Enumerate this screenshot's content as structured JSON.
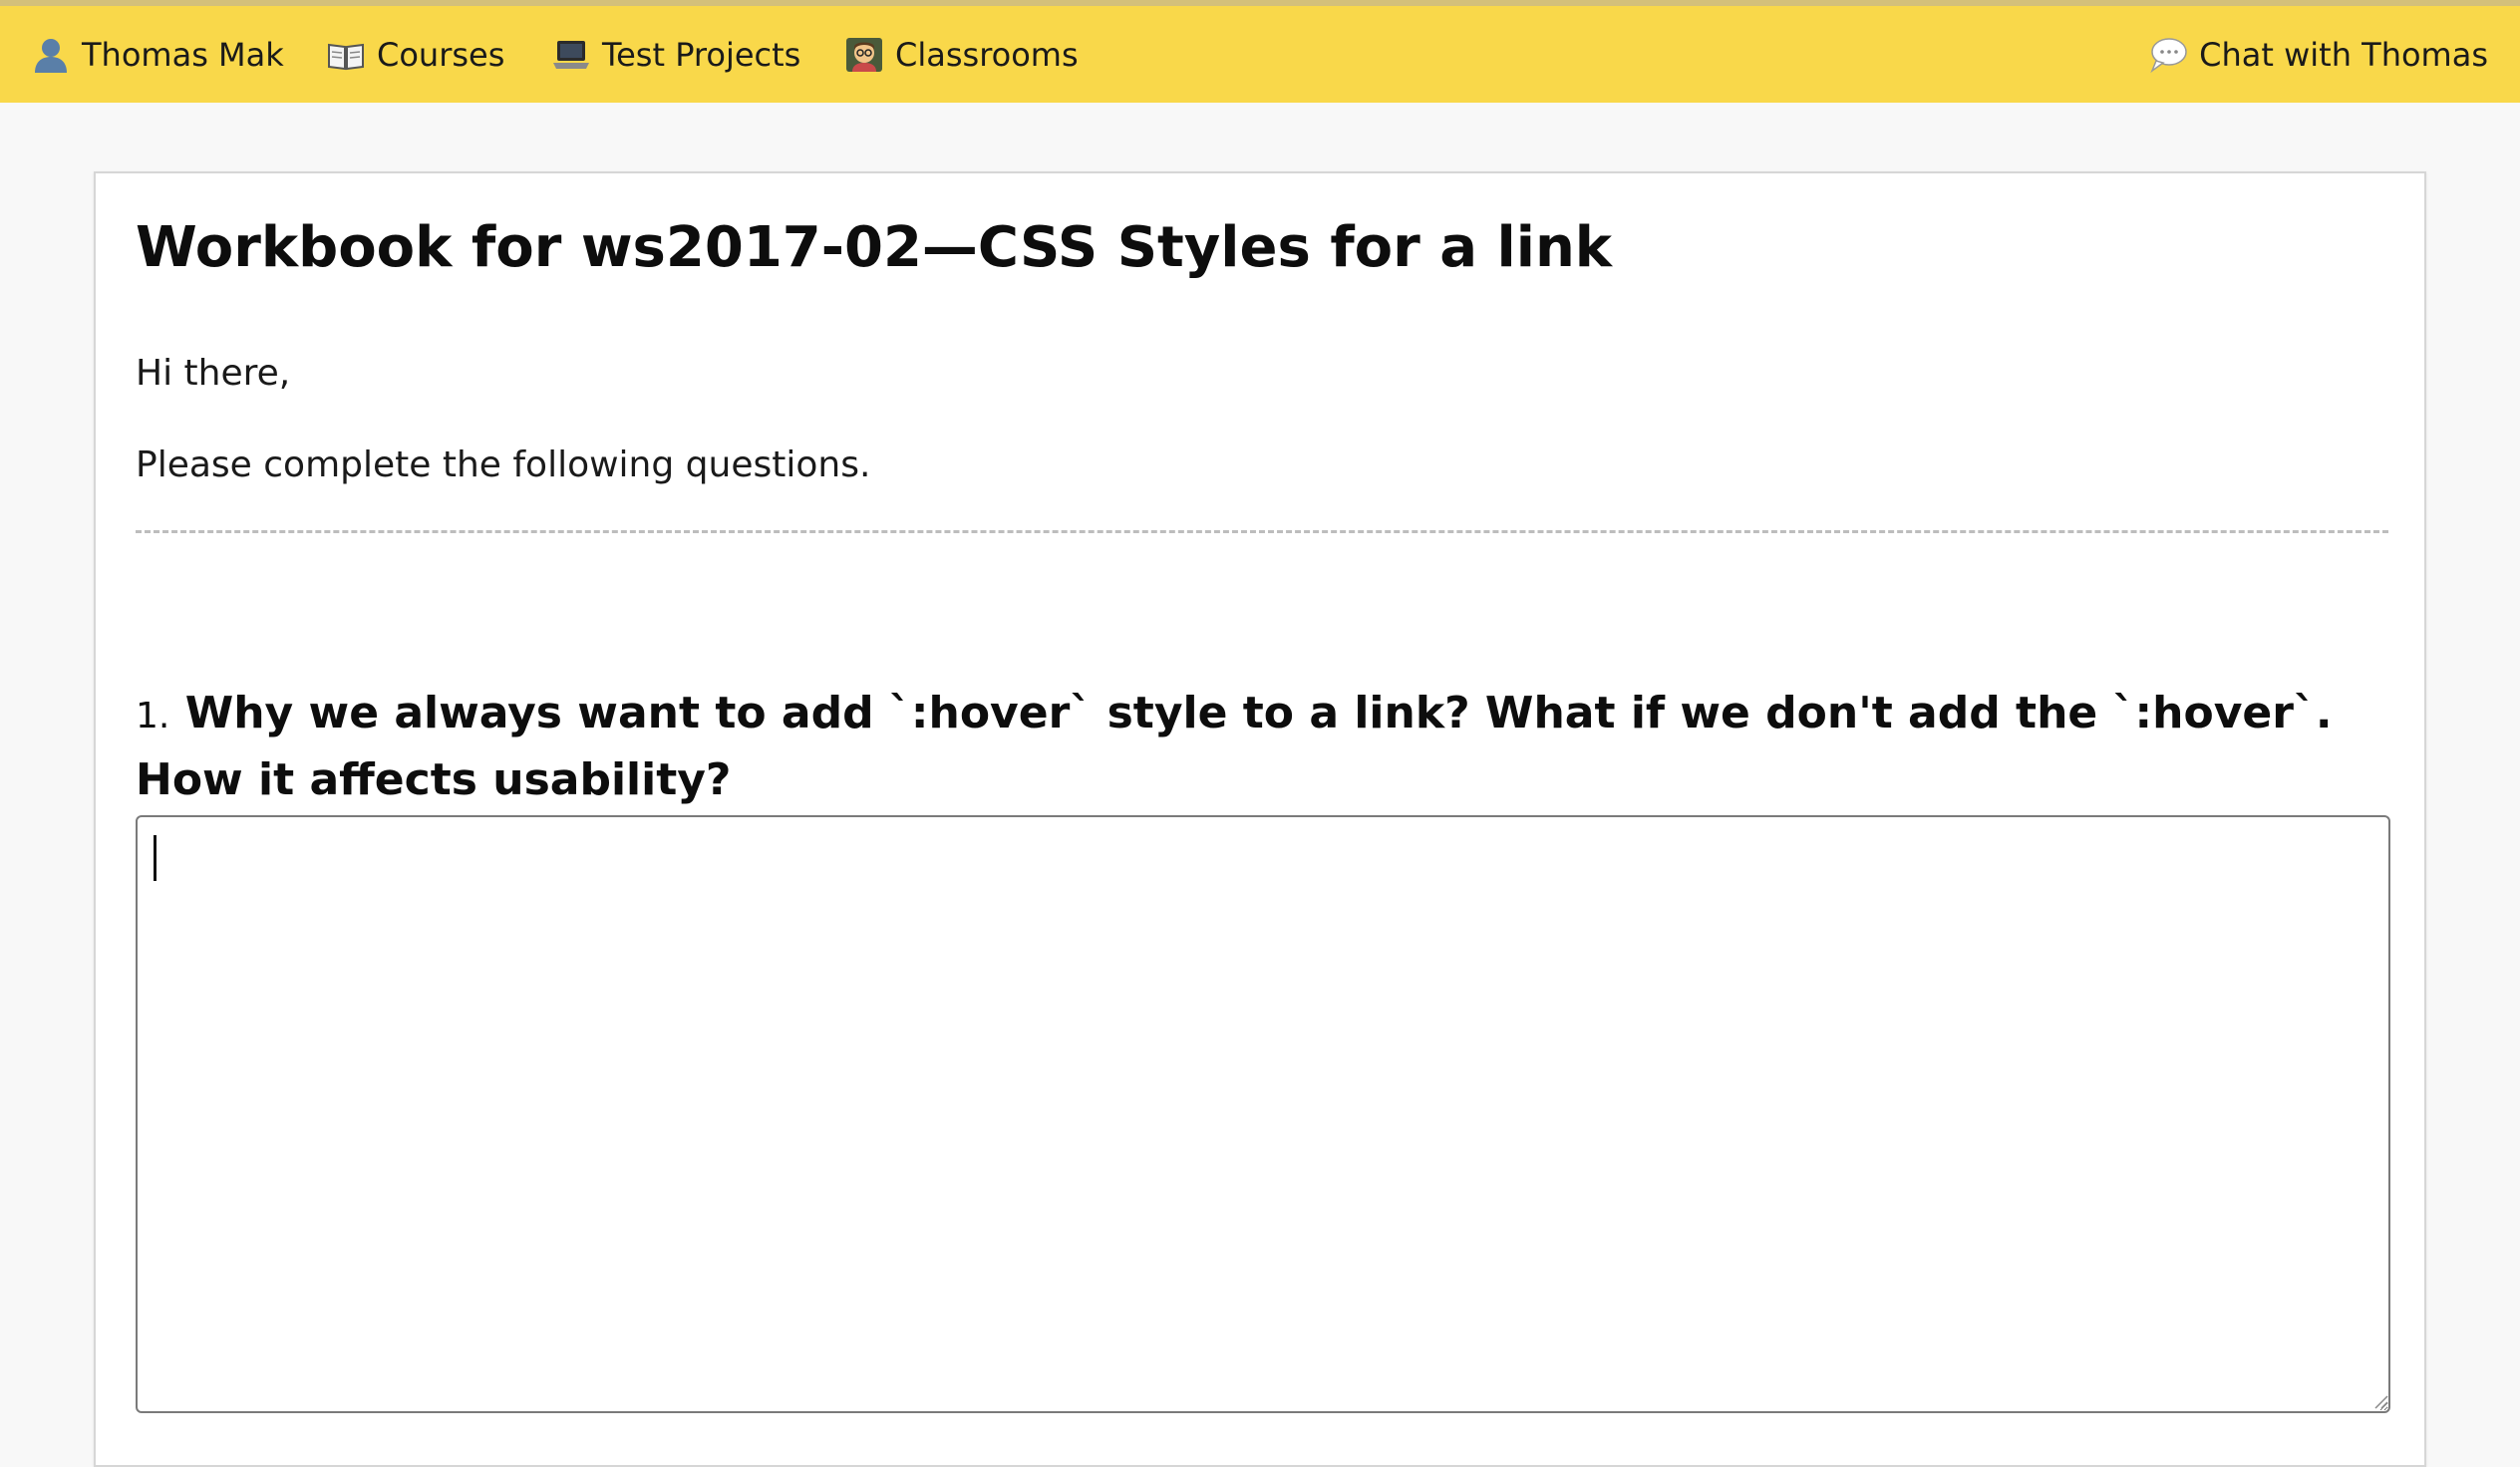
{
  "nav": {
    "user": {
      "label": "Thomas Mak",
      "icon": "user-icon"
    },
    "courses": {
      "label": "Courses",
      "icon": "book-icon"
    },
    "test_projects": {
      "label": "Test Projects",
      "icon": "laptop-icon"
    },
    "classrooms": {
      "label": "Classrooms",
      "icon": "teacher-icon"
    },
    "chat": {
      "label": "Chat with Thomas",
      "icon": "speech-bubble-icon"
    }
  },
  "workbook": {
    "title": "Workbook for ws2017-02—CSS Styles for a link",
    "greeting": "Hi there,",
    "instructions": "Please complete the following questions."
  },
  "questions": [
    {
      "number": "1.",
      "text": "Why we always want to add `:hover` style to a link? What if we don't add the `:hover`. How it affects usability?",
      "answer": ""
    }
  ],
  "colors": {
    "topbar": "#f9d84a",
    "page_background": "#f8f8f8",
    "card_background": "#ffffff"
  }
}
